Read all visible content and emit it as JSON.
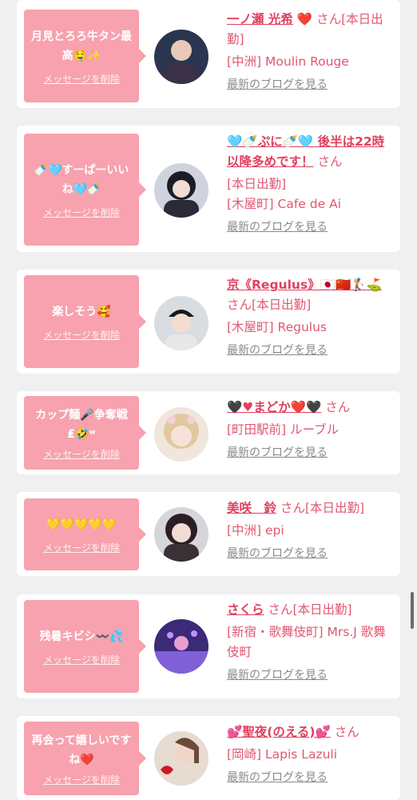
{
  "delete_label": "メッセージを削除",
  "blog_label": "最新のブログを見る",
  "san_label": "さん",
  "items": [
    {
      "message": "月見とろろ牛タン最高🤤✨",
      "name": "一ノ瀬 光希",
      "name_suffix": "❤️",
      "tag": "[本日出勤]",
      "location": "[中洲] Moulin Rouge"
    },
    {
      "message": "🍼🩵すーぱーいいね🩵🍼",
      "name": "🩵🍼ぷに🍼🩵 後半は22時以降多めです！",
      "name_suffix": "",
      "tag": "[本日出勤]",
      "location": "[木屋町] Cafe de Ai"
    },
    {
      "message": "楽しそう🥰",
      "name": "京《Regulus》🇯🇵🇨🇳🏌️⛳",
      "name_suffix": "",
      "tag": "[本日出勤]",
      "location": "[木屋町] Regulus"
    },
    {
      "message": "カップ麺🎤争奪戦₤🤣ʷ",
      "name": "🖤♥まどか❤️🖤",
      "name_suffix": "",
      "tag": "",
      "location": "[町田駅前] ルーブル"
    },
    {
      "message": "💛💛💛💛💛",
      "name": "美咲　鈴",
      "name_suffix": "",
      "tag": "[本日出勤]",
      "location": "[中洲] epi"
    },
    {
      "message": "残暑キビシ〰️💦",
      "name": "さくら",
      "name_suffix": "",
      "tag": "[本日出勤]",
      "location": "[新宿・歌舞伎町] Mrs.J 歌舞伎町"
    },
    {
      "message": "再会って嬉しいですね❤️",
      "name": "💕聖夜(のえる)💕",
      "name_suffix": "",
      "tag": "",
      "location": "[岡崎] Lapis Lazuli"
    }
  ]
}
